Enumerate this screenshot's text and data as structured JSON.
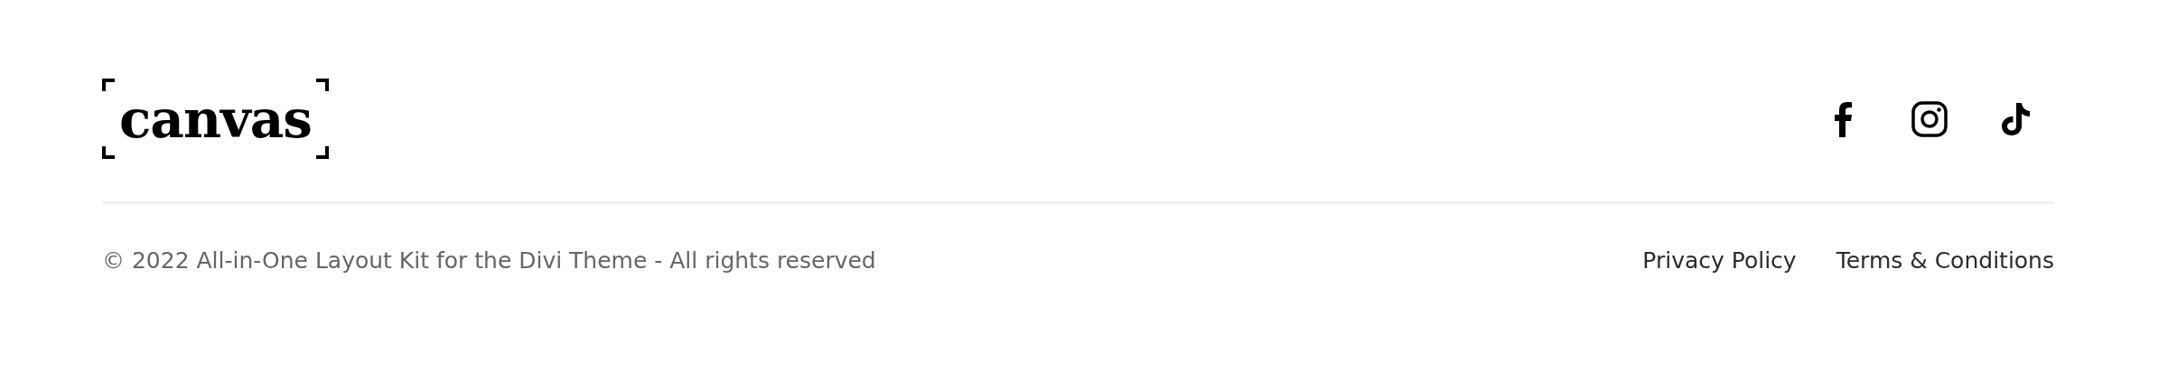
{
  "logo": {
    "text": "canvas"
  },
  "social_links": [
    {
      "kind": "facebook"
    },
    {
      "kind": "instagram"
    },
    {
      "kind": "tiktok"
    }
  ],
  "copyright": "© 2022 All-in-One Layout Kit for the Divi Theme - All rights reserved",
  "footer_links": [
    "Privacy Policy",
    "Terms & Conditions"
  ]
}
